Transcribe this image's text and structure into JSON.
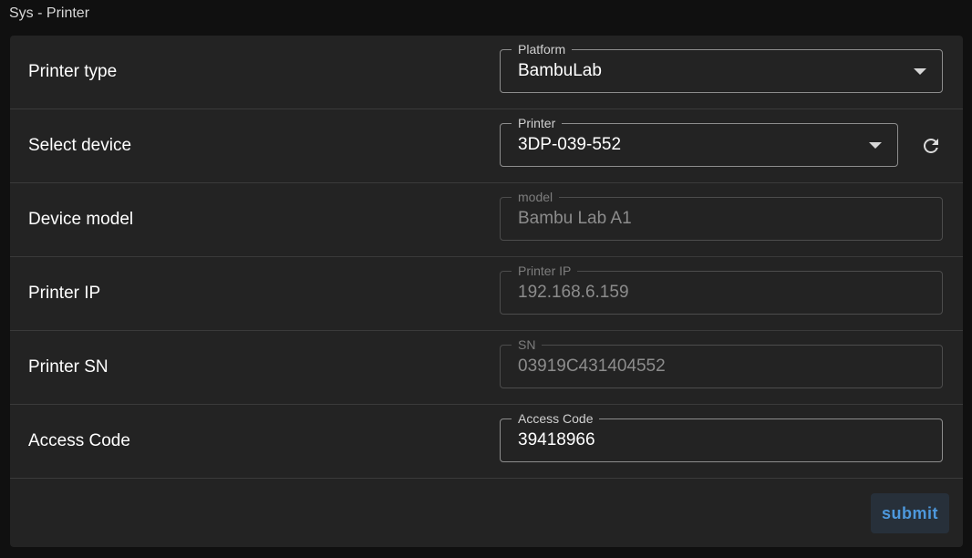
{
  "page": {
    "title": "Sys - Printer"
  },
  "form": {
    "rows": [
      {
        "label": "Printer type",
        "field_label": "Platform",
        "value": "BambuLab"
      },
      {
        "label": "Select device",
        "field_label": "Printer",
        "value": "3DP-039-552"
      },
      {
        "label": "Device model",
        "field_label": "model",
        "value": "Bambu Lab A1"
      },
      {
        "label": "Printer IP",
        "field_label": "Printer IP",
        "value": "192.168.6.159"
      },
      {
        "label": "Printer SN",
        "field_label": "SN",
        "value": "03919C431404552"
      },
      {
        "label": "Access Code",
        "field_label": "Access Code",
        "value": "39418966"
      }
    ],
    "submit_label": "submit"
  },
  "icons": {
    "dropdown": "chevron-down-icon",
    "refresh": "refresh-icon"
  },
  "colors": {
    "accent": "#4d98dc",
    "card": "#232323",
    "background": "#101010"
  }
}
